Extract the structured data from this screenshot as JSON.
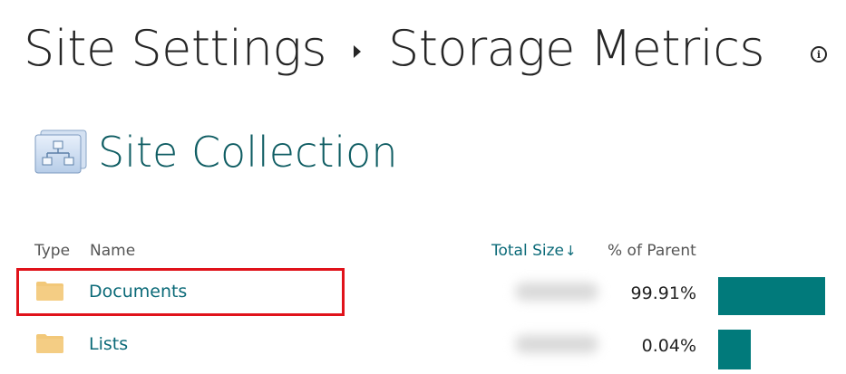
{
  "breadcrumb": {
    "parent": "Site Settings",
    "current": "Storage Metrics"
  },
  "section": {
    "title": "Site Collection",
    "icon": "site-collection-icon"
  },
  "table": {
    "headers": {
      "type": "Type",
      "name": "Name",
      "total_size": "Total Size",
      "total_size_sort": "↓",
      "percent_of_parent": "% of Parent"
    },
    "rows": [
      {
        "type_icon": "folder-icon",
        "name": "Documents",
        "percent": "99.91%",
        "percent_value": 99.91,
        "highlighted": true
      },
      {
        "type_icon": "folder-icon",
        "name": "Lists",
        "percent": "0.04%",
        "percent_value": 0.04,
        "highlighted": false
      }
    ]
  },
  "colors": {
    "accent": "#0b6a78",
    "bar": "#017a7b",
    "title_teal": "#0f5d63",
    "highlight": "#e0121a",
    "folder": "#f2c879"
  }
}
